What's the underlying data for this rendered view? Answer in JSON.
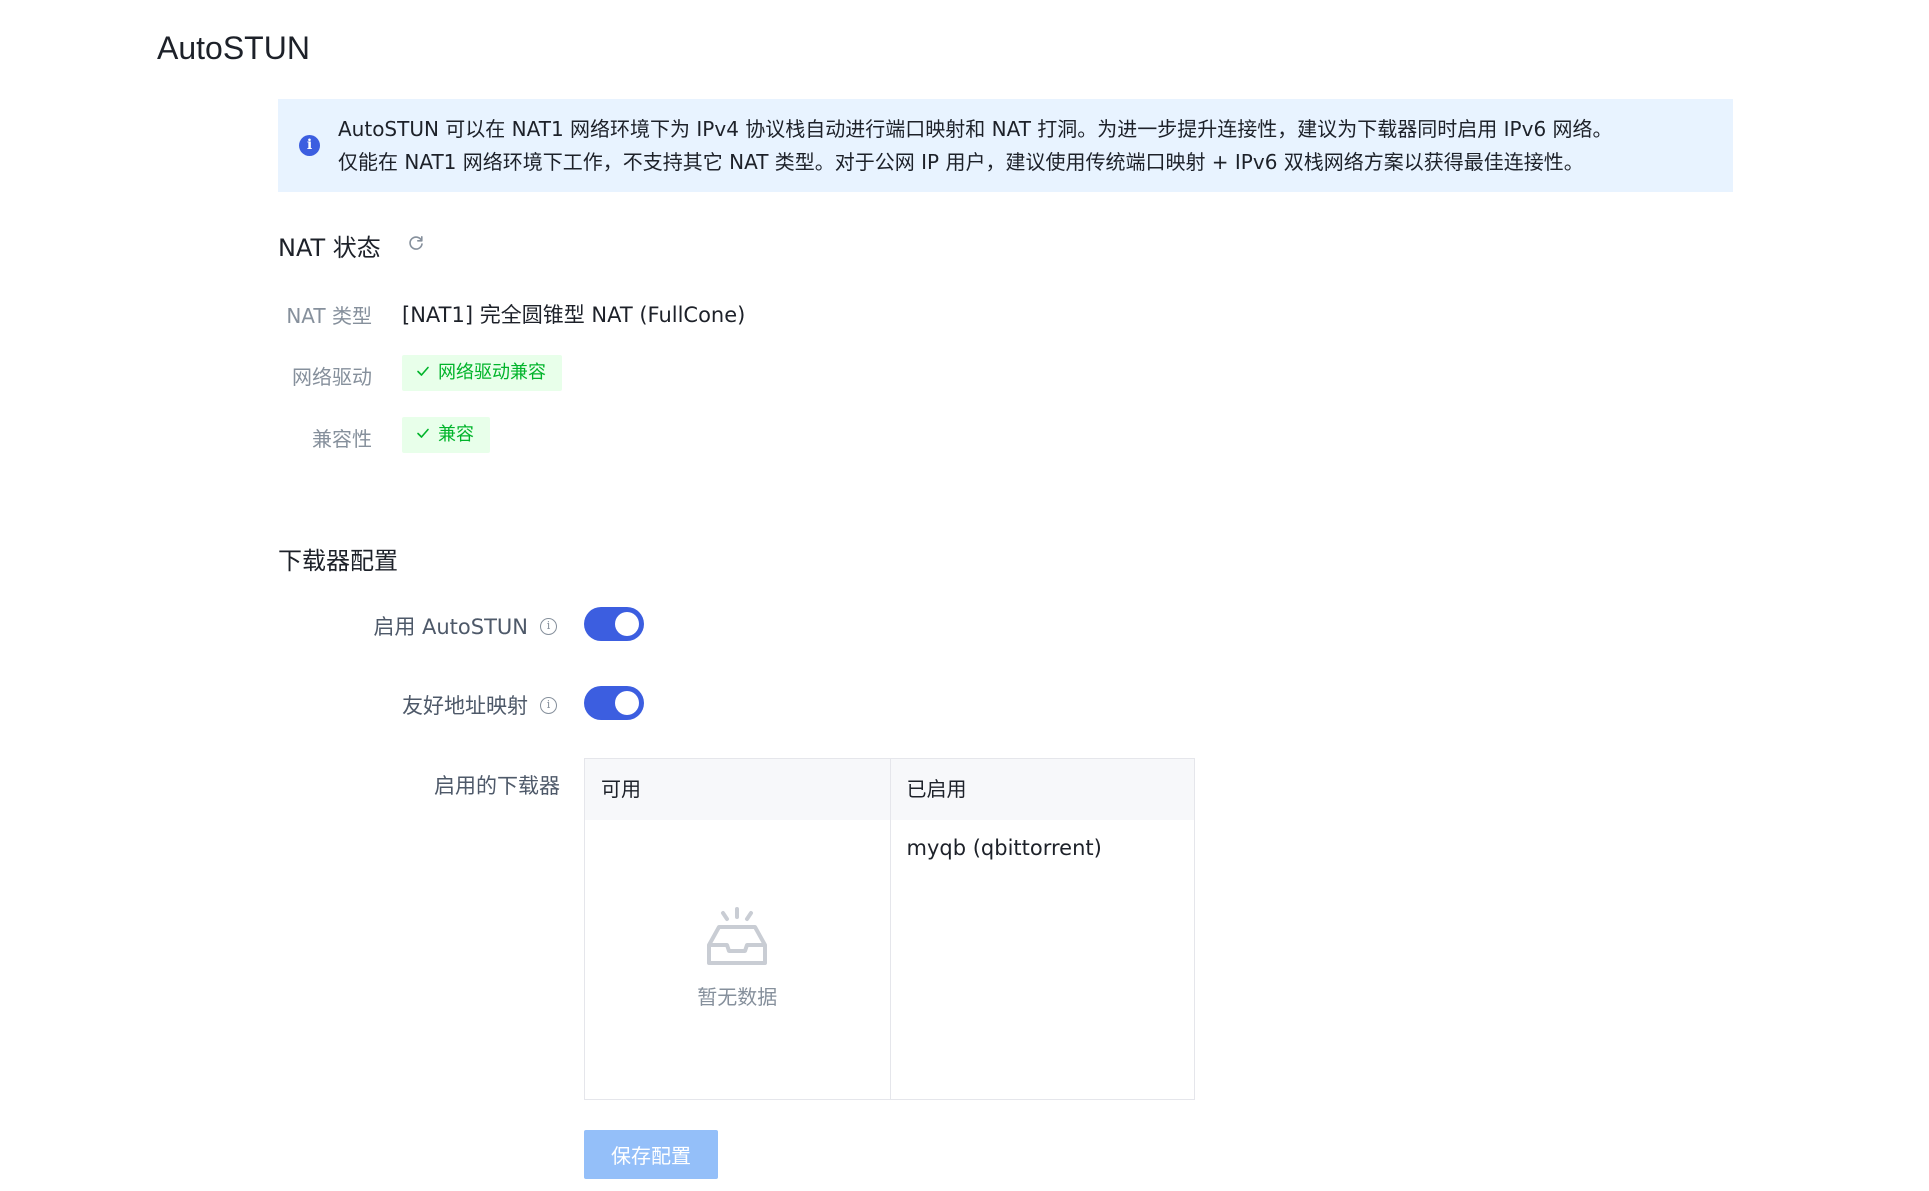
{
  "page": {
    "title": "AutoSTUN"
  },
  "alert": {
    "icon": "info-icon",
    "line1": "AutoSTUN 可以在 NAT1 网络环境下为 IPv4 协议栈自动进行端口映射和 NAT 打洞。为进一步提升连接性，建议为下载器同时启用 IPv6 网络。",
    "line2": "仅能在 NAT1 网络环境下工作，不支持其它 NAT 类型。对于公网 IP 用户，建议使用传统端口映射 + IPv6 双栈网络方案以获得最佳连接性。"
  },
  "nat_status": {
    "title": "NAT 状态",
    "refresh_icon": "refresh-icon",
    "rows": [
      {
        "label": "NAT 类型",
        "value": "[NAT1] 完全圆锥型 NAT (FullCone)"
      },
      {
        "label": "网络驱动",
        "tag": "网络驱动兼容"
      },
      {
        "label": "兼容性",
        "tag": "兼容"
      }
    ],
    "tag_color": "#00b42a",
    "tag_bg": "#e8ffea"
  },
  "downloader_config": {
    "title": "下载器配置",
    "enable_autostun": {
      "label": "启用 AutoSTUN",
      "checked": true
    },
    "friendly_mapping": {
      "label": "友好地址映射",
      "checked": true
    },
    "enabled_downloaders": {
      "label": "启用的下载器",
      "available_header": "可用",
      "enabled_header": "已启用",
      "available_items": [],
      "empty_text": "暂无数据",
      "enabled_items": [
        "myqb (qbittorrent)"
      ]
    },
    "save_label": "保存配置"
  },
  "colors": {
    "primary": "#3c5ee0",
    "alert_bg": "#e8f3ff",
    "save_disabled_bg": "#94bff9",
    "muted_text": "#86909c"
  }
}
